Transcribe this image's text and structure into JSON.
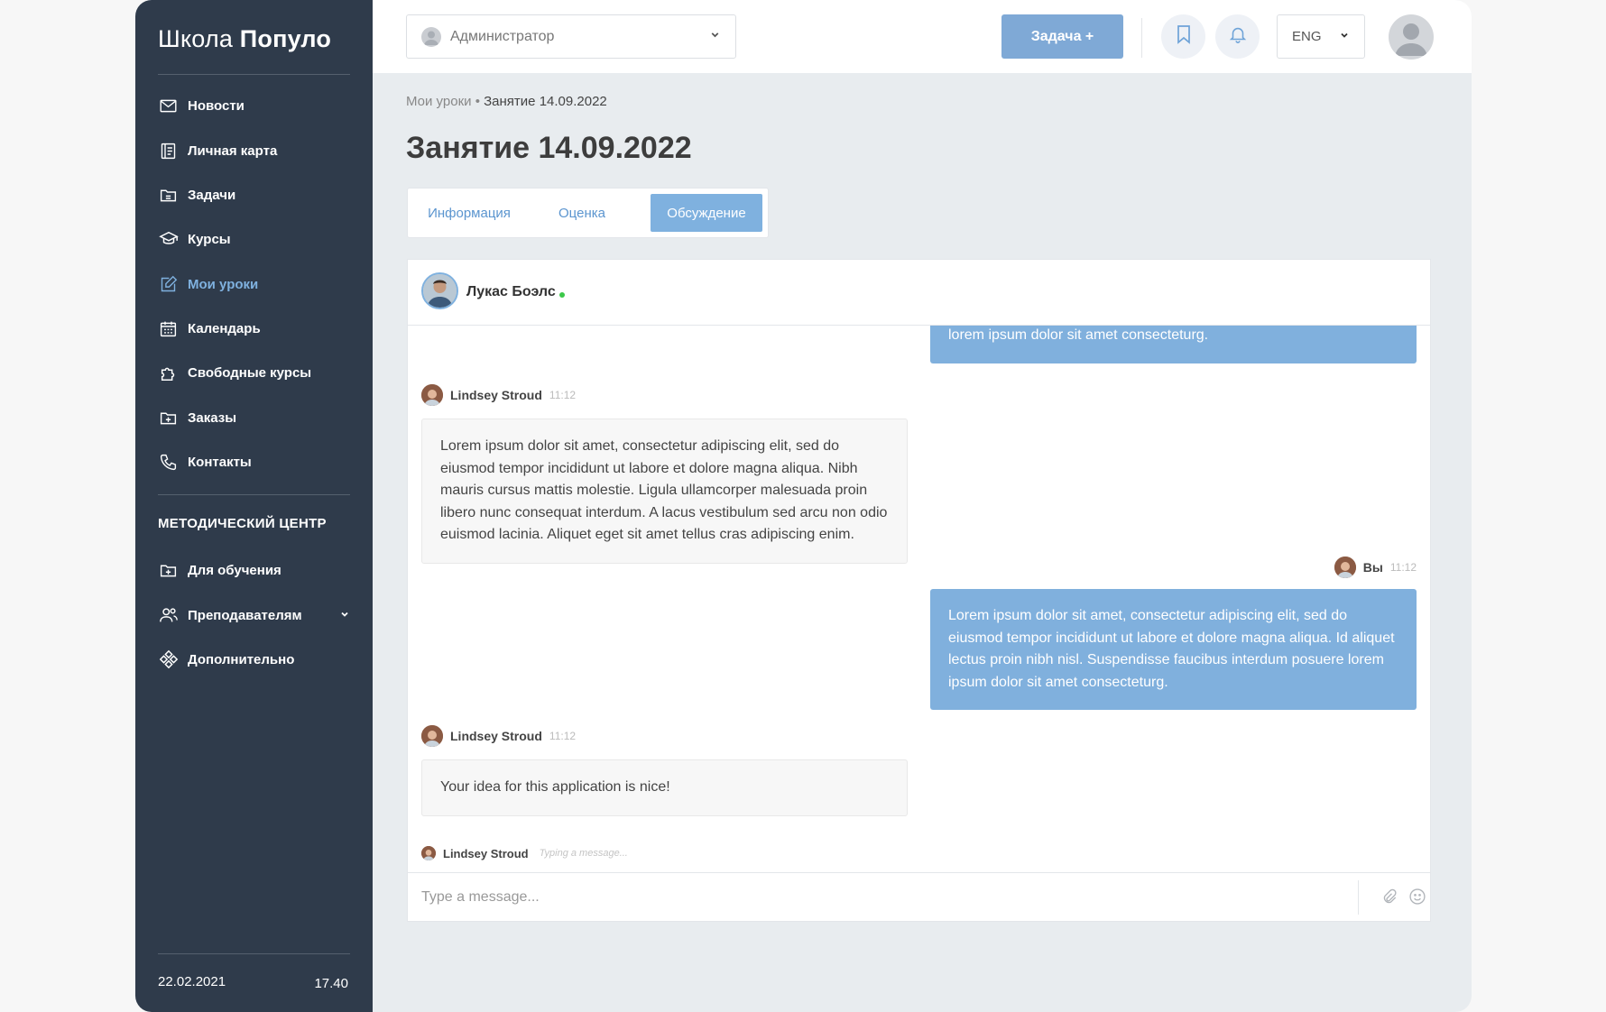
{
  "sidebar": {
    "logo_light": "Школа",
    "logo_bold": "Популо",
    "items": [
      {
        "label": "Новости",
        "icon": "mail-icon"
      },
      {
        "label": "Личная карта",
        "icon": "card-icon"
      },
      {
        "label": "Задачи",
        "icon": "folder-icon"
      },
      {
        "label": "Курсы",
        "icon": "graduation-cap-icon"
      },
      {
        "label": "Мои уроки",
        "icon": "edit-icon",
        "active": true
      },
      {
        "label": "Календарь",
        "icon": "calendar-icon"
      },
      {
        "label": "Свободные курсы",
        "icon": "puzzle-icon"
      },
      {
        "label": "Заказы",
        "icon": "folder-plus-icon"
      },
      {
        "label": "Контакты",
        "icon": "phone-icon"
      }
    ],
    "section_title": "МЕТОДИЧЕСКИЙ ЦЕНТР",
    "section_items": [
      {
        "label": "Для обучения",
        "icon": "folder-plus-icon"
      },
      {
        "label": "Преподавателям",
        "icon": "users-icon"
      },
      {
        "label": "Дополнительно",
        "icon": "diamond-icon"
      }
    ],
    "footer_date": "22.02.2021",
    "footer_time": "17.40"
  },
  "topbar": {
    "role": "Администратор",
    "task_button": "Задача +",
    "language": "ENG"
  },
  "breadcrumb": {
    "parent": "Мои уроки",
    "separator": "•",
    "current": "Занятие 14.09.2022"
  },
  "page_title": "Занятие 14.09.2022",
  "tabs": [
    {
      "label": "Информация"
    },
    {
      "label": "Оценка"
    },
    {
      "label": "Обсуждение",
      "active": true
    }
  ],
  "chat": {
    "contact_name": "Лукас Боэлс",
    "contact_status": "online",
    "messages": [
      {
        "direction": "out",
        "text": "lorem ipsum dolor sit amet consecteturg."
      },
      {
        "direction": "in",
        "author": "Lindsey Stroud",
        "time": "11:12",
        "text": "Lorem ipsum dolor sit amet, consectetur adipiscing elit, sed do eiusmod tempor incididunt ut labore et dolore magna aliqua. Nibh mauris cursus mattis molestie. Ligula ullamcorper malesuada proin libero nunc consequat interdum. A lacus vestibulum sed arcu non odio euismod lacinia. Aliquet eget sit amet tellus cras adipiscing enim."
      },
      {
        "direction": "out",
        "author": "Вы",
        "time": "11:12",
        "text": "Lorem ipsum dolor sit amet, consectetur adipiscing elit, sed do eiusmod tempor incididunt ut labore et dolore magna aliqua. Id aliquet lectus proin nibh nisl. Suspendisse faucibus interdum posuere lorem ipsum dolor sit amet consecteturg."
      },
      {
        "direction": "in",
        "author": "Lindsey Stroud",
        "time": "11:12",
        "text": "Your idea for this application is nice!"
      }
    ],
    "typing_user": "Lindsey Stroud",
    "typing_text": "Typing a message...",
    "composer_placeholder": "Type a message..."
  },
  "colors": {
    "sidebar_bg": "#2f3b4b",
    "accent": "#7fb1df",
    "outgoing_bubble": "#80b0dd",
    "online": "#3cc84a"
  }
}
